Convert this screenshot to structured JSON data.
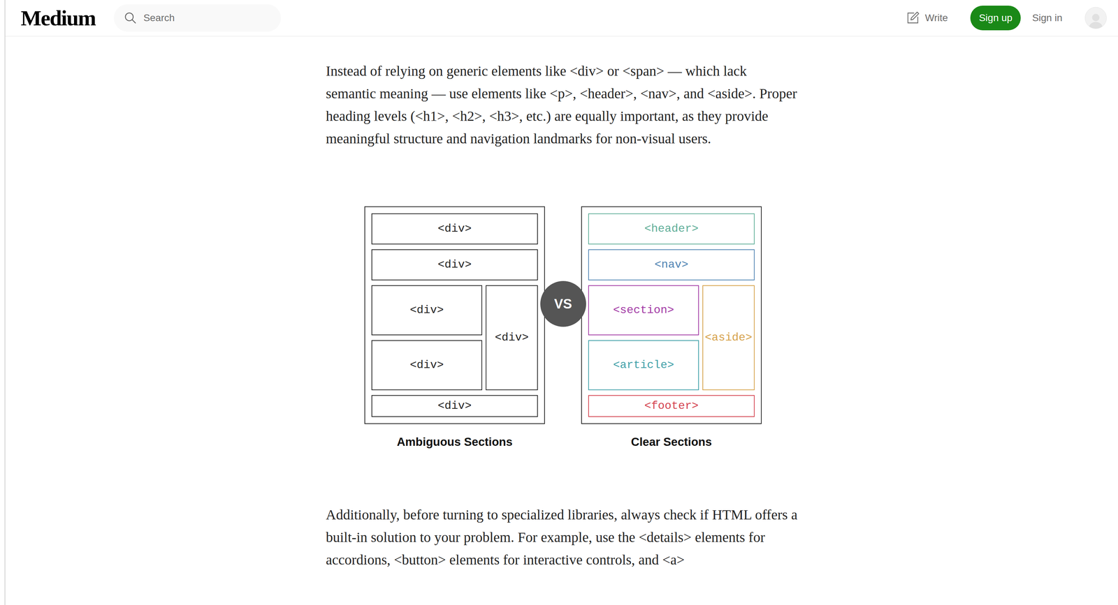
{
  "header": {
    "logo": "Medium",
    "search": {
      "placeholder": "Search"
    },
    "write": "Write",
    "sign_up": "Sign up",
    "sign_in": "Sign in"
  },
  "article": {
    "paragraphs_before": [
      "Instead of relying on generic elements like <div> or <span> — which lack semantic meaning — use elements like <p>, <header>, <nav>, and <aside>. Proper heading levels (<h1>, <h2>, <h3>, etc.) are equally important, as they provide meaningful structure and navigation landmarks for non-visual users."
    ],
    "figure": {
      "vs": "VS",
      "panels": [
        {
          "caption": "Ambiguous Sections",
          "boxes": [
            {
              "label": "<div>",
              "color": "#242424"
            },
            {
              "label": "<div>",
              "color": "#242424"
            },
            {
              "label": "<div>",
              "color": "#242424"
            },
            {
              "label": "<div>",
              "color": "#242424"
            },
            {
              "label": "<div>",
              "color": "#242424"
            },
            {
              "label": "<div>",
              "color": "#242424"
            }
          ]
        },
        {
          "caption": "Clear Sections",
          "boxes": [
            {
              "label": "<header>",
              "color": "#5fae98"
            },
            {
              "label": "<nav>",
              "color": "#4f84b3"
            },
            {
              "label": "<section>",
              "color": "#a23aa5"
            },
            {
              "label": "<aside>",
              "color": "#d6a24a"
            },
            {
              "label": "<article>",
              "color": "#3fa0a8"
            },
            {
              "label": "<footer>",
              "color": "#d4434f"
            }
          ]
        }
      ]
    },
    "paragraphs_after": [
      "Additionally, before turning to specialized libraries, always check if HTML offers a built-in solution to your problem. For example, use the <details> elements for accordions, <button> elements for interactive controls, and <a>"
    ]
  }
}
